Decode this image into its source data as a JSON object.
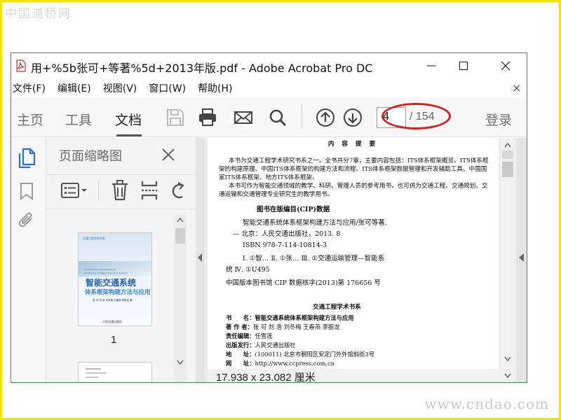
{
  "watermark": {
    "top": "中国道桥网",
    "bottom": "www.cndao.com"
  },
  "window": {
    "title": "用+%5b张可+等著%5d+2013年版.pdf - Adobe Acrobat Pro DC",
    "menu": [
      "文件(F)",
      "编辑(E)",
      "视图(V)",
      "窗口(W)",
      "帮助(H)"
    ],
    "close_doc": "×"
  },
  "toolbar": {
    "tabs": [
      "主页",
      "工具",
      "文档"
    ],
    "active_tab": "文档",
    "page_current": "4",
    "page_total": "/ 154",
    "login": "登录"
  },
  "thumbnails": {
    "panel_title": "页面缩略图",
    "page1_label": "1",
    "cover": {
      "series": "交通工程学术书系",
      "en_line1": "Principles and Applications for",
      "en_line2": "Developing Intelligent Transport Systems",
      "title": "智能交通系统",
      "subtitle": "体系框架构建方法与应用",
      "authors": "张 可 刘 浩 刘冬梅 王春燕 李振龙 著",
      "publisher": "人民交通出版社"
    }
  },
  "document": {
    "heading": "内 容 提 要",
    "para1": [
      "本书为交通工程学术研究书系之一。全书共分7章，主要内容包括：ITS体系框架概览、ITS体系框",
      "架的构建原理、中国ITS体系框架的构建方法和流程、ITS体系框架数据管理和开发辅助工具、中国国",
      "家ITS体系框架、地方ITS体系框架。"
    ],
    "para2": [
      "本书可作为智能交通领域的教学、科研、管理人员的参考用书，也可供为交通工程、交通规划、交",
      "通运输和交通管理专业研究生的教学用书。"
    ],
    "cip_heading": "图书在版编目(CIP)数据",
    "cip_lines": [
      "智能交通系统体系框架构建方法与应用/张可等著.",
      "— 北京：人民交通出版社，2013. 8",
      "ISBN  978-7-114-10814-3",
      "Ⅰ. ①智…  Ⅱ. ①张…  Ⅲ. ①交通运输管理—智能系",
      "统  Ⅳ. ①U495"
    ],
    "cip_number": "中国版本图书馆 CIP 数据核字(2013)第 176656 号",
    "series_heading": "交通工程学术书系",
    "info": [
      {
        "label": "书　　名：",
        "value": "智能交通系统体系框架构建方法与应用"
      },
      {
        "label": "著 作 者：",
        "value": "张  可  刘  浩   刘冬梅   王春燕   李振龙"
      },
      {
        "label": "责任编辑：",
        "value": "任雪莲"
      },
      {
        "label": "出版发行：",
        "value": "人民交通出版社"
      },
      {
        "label": "地　　址：",
        "value": "(100011) 北京市朝阳区安定门外外馆斜街3号"
      },
      {
        "label": "网　　址：",
        "value": "http://www.ccpress.com.cn"
      }
    ],
    "page_size": "17.938 x 23.082 厘米"
  },
  "colors": {
    "accent": "#2b6fd6",
    "annotation": "#d62020",
    "frame": "#f2e600"
  }
}
